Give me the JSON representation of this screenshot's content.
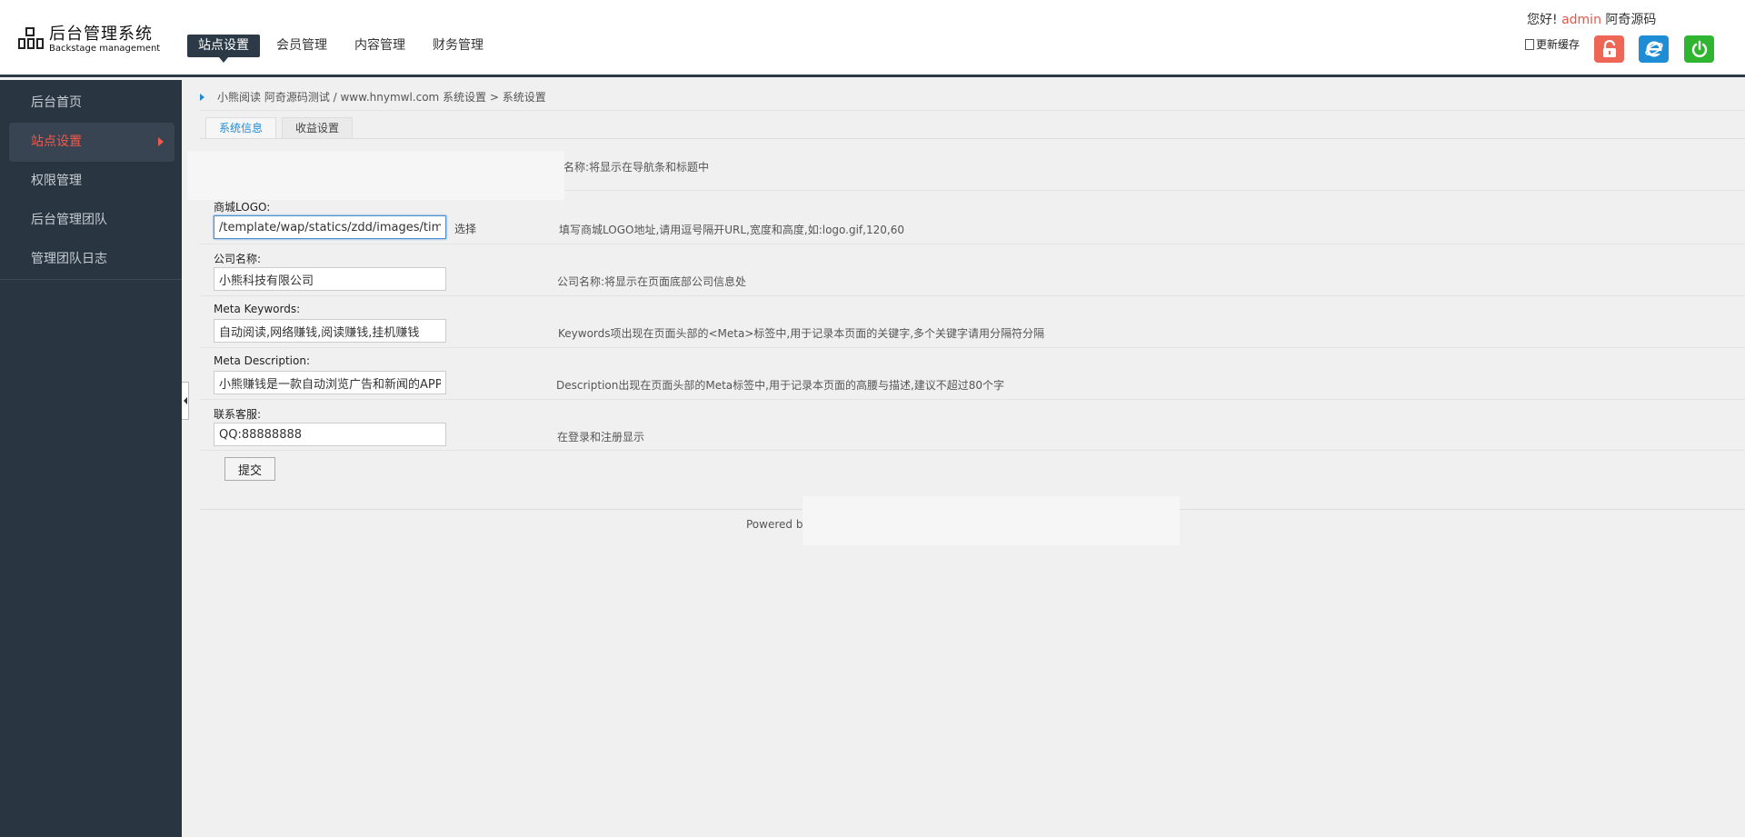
{
  "header": {
    "logo_title": "后台管理系统",
    "logo_subtitle": "Backstage management",
    "nav": [
      {
        "label": "站点设置",
        "active": true
      },
      {
        "label": "会员管理",
        "active": false
      },
      {
        "label": "内容管理",
        "active": false
      },
      {
        "label": "财务管理",
        "active": false
      }
    ],
    "greeting_prefix": "您好!",
    "greeting_user": "admin",
    "greeting_suffix": "阿奇源码",
    "clear_cache": "更新缓存",
    "icons": [
      "lock-icon",
      "ie-icon",
      "power-icon"
    ],
    "colors": {
      "lock": "#ee6656",
      "ie": "#1f8dd6",
      "power": "#2fb52f",
      "dark": "#2c3a48",
      "accent_red": "#f0594c"
    }
  },
  "sidebar": {
    "items": [
      {
        "label": "后台首页",
        "active": false
      },
      {
        "label": "站点设置",
        "active": true
      },
      {
        "label": "权限管理",
        "active": false
      },
      {
        "label": "后台管理团队",
        "active": false
      },
      {
        "label": "管理团队日志",
        "active": false
      }
    ]
  },
  "breadcrumb": "小熊阅读 阿奇源码测试 / www.hnymwl.com 系统设置 > 系统设置",
  "tabs": [
    {
      "label": "系统信息",
      "active": true
    },
    {
      "label": "收益设置",
      "active": false
    }
  ],
  "form": {
    "site_name_hint": "名称:将显示在导航条和标题中",
    "logo": {
      "label": "商城LOGO:",
      "value": "/template/wap/statics/zdd/images/timg.gif",
      "pick": "选择",
      "hint": "填写商城LOGO地址,请用逗号隔开URL,宽度和高度,如:logo.gif,120,60"
    },
    "company": {
      "label": "公司名称:",
      "value": "小熊科技有限公司",
      "hint": "公司名称:将显示在页面底部公司信息处"
    },
    "keywords": {
      "label": "Meta Keywords:",
      "value": "自动阅读,网络赚钱,阅读赚钱,挂机赚钱",
      "hint": "Keywords项出现在页面头部的<Meta>标签中,用于记录本页面的关键字,多个关键字请用分隔符分隔"
    },
    "description": {
      "label": "Meta Description:",
      "value": "小熊赚钱是一款自动浏览广告和新闻的APP",
      "hint": "Description出现在页面头部的Meta标签中,用于记录本页面的高腰与描述,建议不超过80个字"
    },
    "service": {
      "label": "联系客服:",
      "value": "QQ:88888888",
      "hint": "在登录和注册显示"
    },
    "submit": "提交"
  },
  "footer": "Powered by"
}
